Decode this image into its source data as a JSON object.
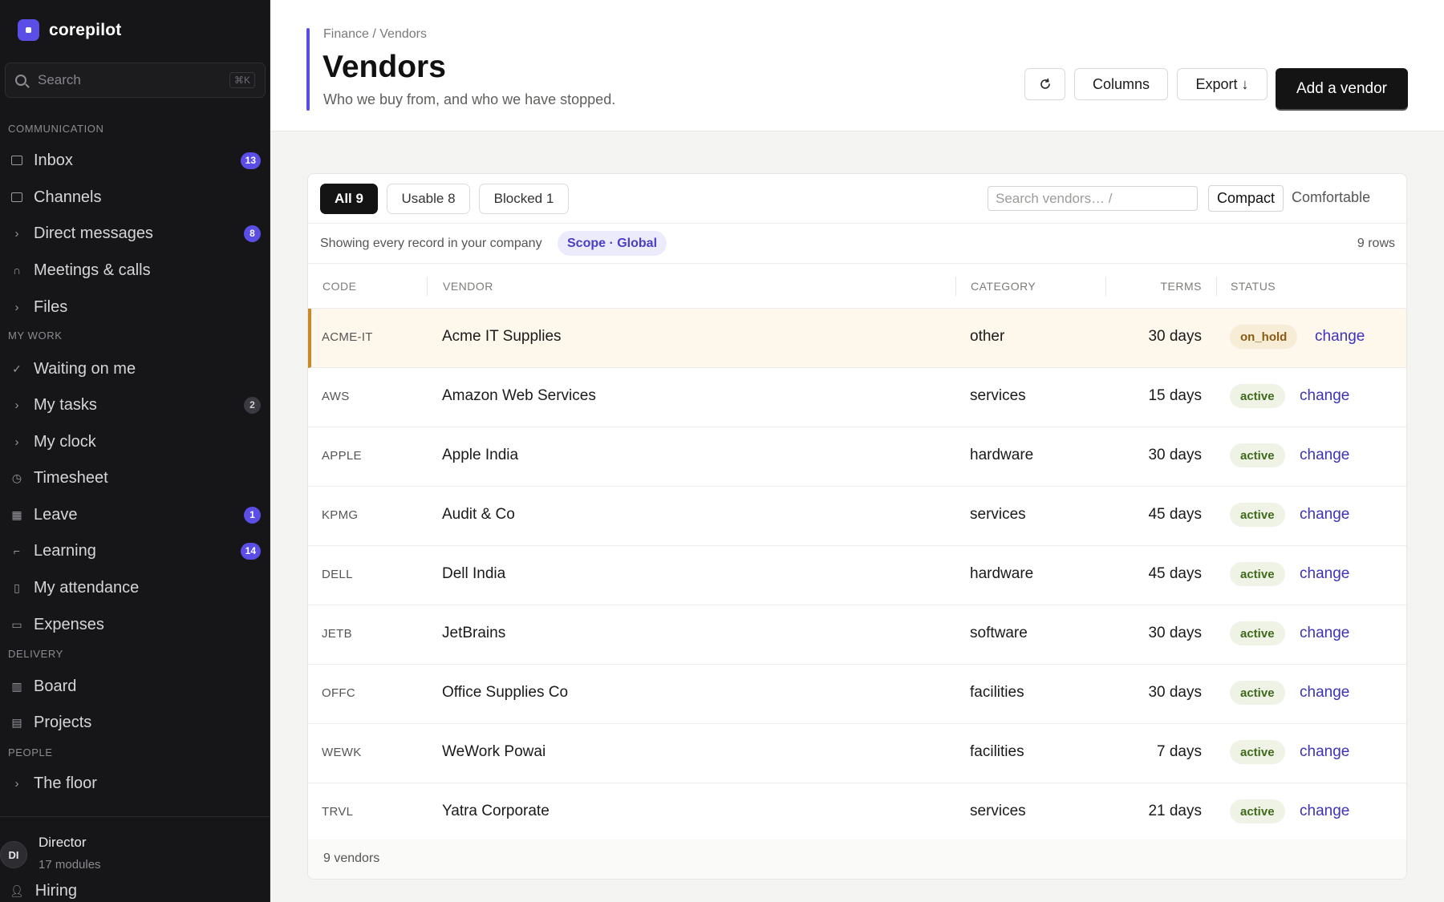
{
  "app": {
    "name": "corepilot",
    "search_placeholder": "Search",
    "search_shortcut": "⌘K"
  },
  "sidebar": {
    "sections": [
      {
        "label": "COMMUNICATION"
      },
      {
        "label": "MY WORK"
      },
      {
        "label": "DELIVERY"
      },
      {
        "label": "PEOPLE"
      }
    ],
    "items": [
      {
        "label": "Inbox",
        "icon": "inbox-icon",
        "badge": "13"
      },
      {
        "label": "Channels",
        "icon": "channels-icon",
        "badge": ""
      },
      {
        "label": "Direct messages",
        "icon": "chevron-right-icon",
        "badge": "8"
      },
      {
        "label": "Meetings & calls",
        "icon": "headphones-icon",
        "badge": ""
      },
      {
        "label": "Files",
        "icon": "chevron-right-icon",
        "badge": ""
      },
      {
        "label": "Waiting on me",
        "icon": "check-icon",
        "badge": ""
      },
      {
        "label": "My tasks",
        "icon": "chevron-right-icon",
        "badge": "2"
      },
      {
        "label": "My clock",
        "icon": "chevron-right-icon",
        "badge": ""
      },
      {
        "label": "Timesheet",
        "icon": "clock-icon",
        "badge": ""
      },
      {
        "label": "Leave",
        "icon": "calendar-icon",
        "badge": "1"
      },
      {
        "label": "Learning",
        "icon": "learning-icon",
        "badge": "14"
      },
      {
        "label": "My attendance",
        "icon": "phone-icon",
        "badge": ""
      },
      {
        "label": "Expenses",
        "icon": "card-icon",
        "badge": ""
      },
      {
        "label": "Board",
        "icon": "board-icon",
        "badge": ""
      },
      {
        "label": "Projects",
        "icon": "briefcase-icon",
        "badge": ""
      },
      {
        "label": "The floor",
        "icon": "chevron-right-icon",
        "badge": ""
      }
    ],
    "footer": {
      "avatar_initials": "DI",
      "name": "Director",
      "subtitle": "17 modules",
      "next_item": "Hiring"
    }
  },
  "header": {
    "breadcrumb": "Finance / Vendors",
    "title": "Vendors",
    "subtitle": "Who we buy from, and who we have stopped.",
    "refresh_icon": "refresh-icon",
    "columns_label": "Columns",
    "export_label": "Export ↓",
    "add_label": "Add a vendor"
  },
  "filters": {
    "tabs": [
      {
        "label": "All 9",
        "active": true
      },
      {
        "label": "Usable 8",
        "active": false
      },
      {
        "label": "Blocked 1",
        "active": false
      }
    ],
    "search_placeholder": "Search vendors…  /",
    "density_options": [
      "Compact",
      "Comfortable"
    ],
    "density_selected": "Compact"
  },
  "scope": {
    "text": "Showing every record in your company",
    "chip": "Scope · Global",
    "row_count": "9 rows"
  },
  "table": {
    "columns": [
      "CODE",
      "VENDOR",
      "CATEGORY",
      "TERMS",
      "STATUS"
    ],
    "rows": [
      {
        "code": "ACME-IT",
        "vendor": "Acme IT Supplies",
        "category": "other",
        "terms": "30 days",
        "status": "on_hold",
        "action": "change"
      },
      {
        "code": "AWS",
        "vendor": "Amazon Web Services",
        "category": "services",
        "terms": "15 days",
        "status": "active",
        "action": "change"
      },
      {
        "code": "APPLE",
        "vendor": "Apple India",
        "category": "hardware",
        "terms": "30 days",
        "status": "active",
        "action": "change"
      },
      {
        "code": "KPMG",
        "vendor": "Audit & Co",
        "category": "services",
        "terms": "45 days",
        "status": "active",
        "action": "change"
      },
      {
        "code": "DELL",
        "vendor": "Dell India",
        "category": "hardware",
        "terms": "45 days",
        "status": "active",
        "action": "change"
      },
      {
        "code": "JETB",
        "vendor": "JetBrains",
        "category": "software",
        "terms": "30 days",
        "status": "active",
        "action": "change"
      },
      {
        "code": "OFFC",
        "vendor": "Office Supplies Co",
        "category": "facilities",
        "terms": "30 days",
        "status": "active",
        "action": "change"
      },
      {
        "code": "WEWK",
        "vendor": "WeWork Powai",
        "category": "facilities",
        "terms": "7 days",
        "status": "active",
        "action": "change"
      },
      {
        "code": "TRVL",
        "vendor": "Yatra Corporate",
        "category": "services",
        "terms": "21 days",
        "status": "active",
        "action": "change"
      }
    ],
    "footer": "9 vendors"
  },
  "colors": {
    "accent": "#5b4ee6",
    "sidebar_bg": "#161618",
    "active_badge_bg": "#eef3e6",
    "on_hold_badge_bg": "#f7ecd6",
    "link": "#3c33b8"
  }
}
